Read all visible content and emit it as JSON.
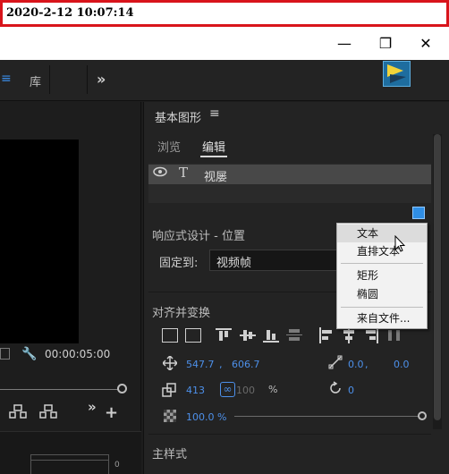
{
  "timestamp": "2020-2-12 10:07:14",
  "window_controls": {
    "minimize": "—",
    "maximize": "❐",
    "close": "✕"
  },
  "tabs": {
    "menu_glyph": "≡",
    "library": "库",
    "overflow": "»"
  },
  "program_monitor": {
    "timecode": "00:00:05:00",
    "wrench": "🔧",
    "bottom_value": "0",
    "controls": {
      "more": "»",
      "add": "+"
    }
  },
  "panel": {
    "title": "基本图形",
    "title_menu": "≡",
    "tabs": [
      "浏览",
      "编辑"
    ],
    "active_tab": "编辑",
    "layer": {
      "icon": "T",
      "name": "视屡"
    },
    "responsive_design": "响应式设计 - 位置",
    "pin_label": "固定到:",
    "pin_value": "视频帧",
    "align_transform": "对齐并变换",
    "position": {
      "x": "547.7",
      "sep": ",",
      "y": "606.7"
    },
    "anchor": {
      "x": "0.0",
      "sep": ",",
      "y": "0.0"
    },
    "scale": "413",
    "scale_height": "100",
    "scale_unit": "%",
    "rotation": "0",
    "opacity": "100.0 %",
    "master_style": "主样式"
  },
  "context_menu": {
    "items": [
      {
        "label": "文本",
        "highlighted": true
      },
      {
        "label": "直排文本",
        "highlighted": false
      },
      {
        "label": "矩形",
        "highlighted": false
      },
      {
        "label": "椭圆",
        "highlighted": false
      },
      {
        "label": "来自文件...",
        "highlighted": false
      }
    ]
  },
  "colors": {
    "accent": "#4d90ea",
    "timestamp_border": "#d8141b"
  }
}
